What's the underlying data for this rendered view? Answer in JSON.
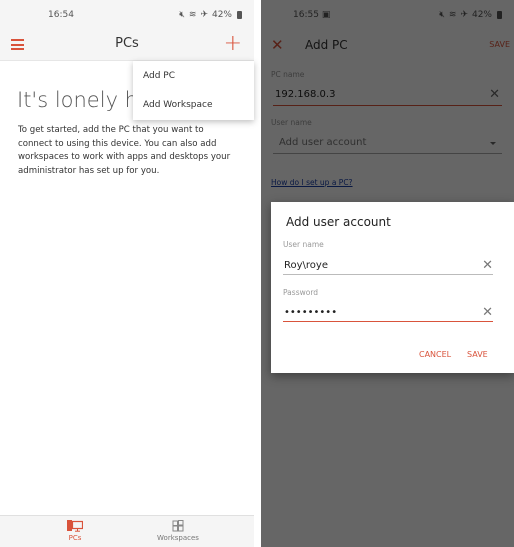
{
  "left_screen": {
    "status_bar": {
      "time": "16:54",
      "battery": "42%",
      "icons": [
        "mute-icon",
        "wifi-icon",
        "airplane-icon",
        "battery-icon"
      ]
    },
    "app_bar": {
      "title": "PCs",
      "menu_icon": "hamburger-menu-icon",
      "add_icon": "plus-icon"
    },
    "dropdown_menu": {
      "items": [
        {
          "label": "Add PC"
        },
        {
          "label": "Add Workspace"
        }
      ]
    },
    "empty_state": {
      "title": "It's lonely here",
      "visible_title": "It's lonely he",
      "description": "To get started, add the PC that you want to connect to using this device. You can also add workspaces to work with apps and desktops your administrator has set up for you."
    },
    "bottom_nav": {
      "items": [
        {
          "label": "PCs",
          "icon": "pc-monitor-icon",
          "active": true
        },
        {
          "label": "Workspaces",
          "icon": "workspaces-grid-icon",
          "active": false
        }
      ]
    }
  },
  "right_screen": {
    "status_bar": {
      "time": "16:55",
      "battery": "42%",
      "icons": [
        "image-icon",
        "mute-icon",
        "wifi-icon",
        "airplane-icon",
        "battery-icon"
      ]
    },
    "app_bar": {
      "title": "Add PC",
      "close_icon": "close-x-icon",
      "save_label": "SAVE"
    },
    "form": {
      "pc_name_label": "PC name",
      "pc_name_value": "192.168.0.3",
      "user_name_label": "User name",
      "user_name_placeholder": "Add user account",
      "help_link": "How do I set up a PC?"
    },
    "dialog": {
      "title": "Add user account",
      "username_label": "User name",
      "username_value": "Roy\\roye",
      "password_label": "Password",
      "password_value": "•••••••••",
      "cancel_label": "CANCEL",
      "save_label": "SAVE"
    }
  },
  "colors": {
    "accent": "#d9533b",
    "link": "#1a3fa8",
    "overlay": "rgba(0,0,0,0.6)"
  }
}
